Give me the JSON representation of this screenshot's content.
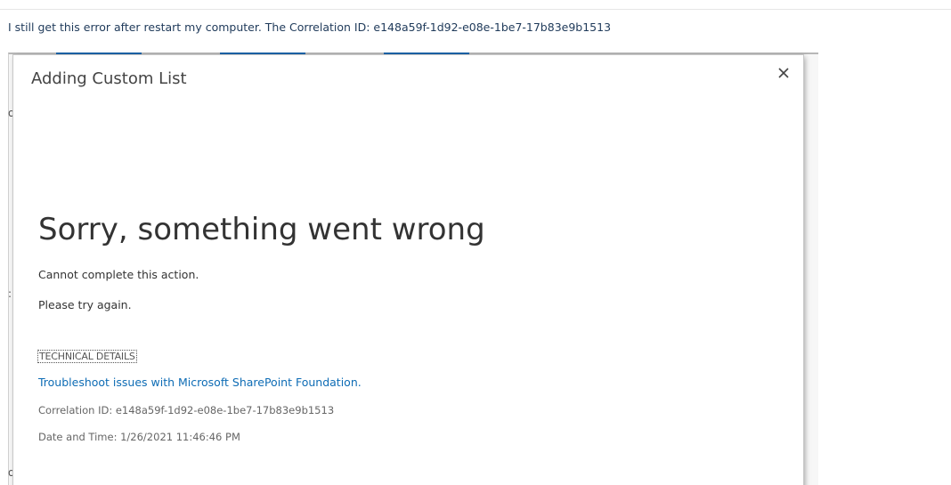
{
  "post": {
    "text": "I still get this error after restart my computer. The Correlation ID: e148a59f-1d92-e08e-1be7-17b83e9b1513"
  },
  "dialog": {
    "title": "Adding Custom List",
    "close_icon": "close-icon",
    "error_heading": "Sorry, something went wrong",
    "message_1": "Cannot complete this action.",
    "message_2": "Please try again.",
    "technical_details_label": "TECHNICAL DETAILS",
    "troubleshoot_link": "Troubleshoot issues with Microsoft SharePoint Foundation.",
    "correlation": "Correlation ID: e148a59f-1d92-e08e-1be7-17b83e9b1513",
    "datetime": "Date and Time: 1/26/2021 11:46:46 PM"
  },
  "colors": {
    "link": "#0e6cb5",
    "post_text": "#1f3a5a",
    "tab_accent": "#1c64a8"
  }
}
